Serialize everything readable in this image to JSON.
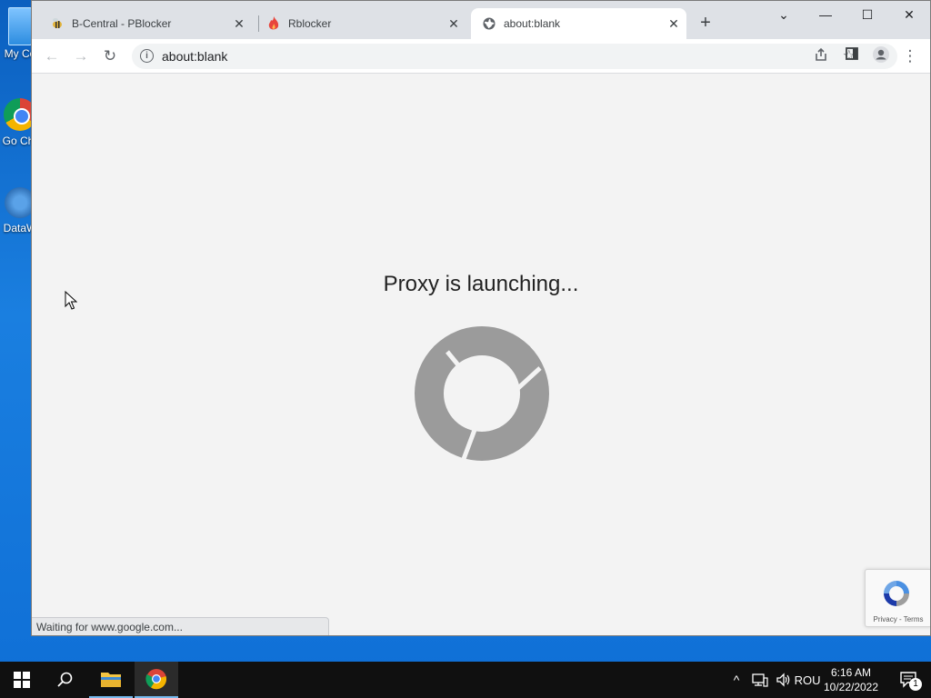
{
  "desktop": {
    "icons": [
      {
        "label": "My Co"
      },
      {
        "label": "Go Chr"
      },
      {
        "label": "DataW"
      }
    ]
  },
  "browser": {
    "tabs": [
      {
        "title": "B-Central - PBlocker",
        "icon": "bee-icon"
      },
      {
        "title": "Rblocker",
        "icon": "flame-icon"
      },
      {
        "title": "about:blank",
        "icon": "globe-icon",
        "active": true
      }
    ],
    "new_tab_label": "+",
    "window_controls": {
      "tab_search": "⌄",
      "minimize": "—",
      "maximize": "☐",
      "close": "✕"
    },
    "toolbar": {
      "back": "←",
      "forward": "→",
      "reload": "↻",
      "url": "about:blank",
      "info": "i"
    }
  },
  "page": {
    "heading": "Proxy is launching...",
    "status": "Waiting for www.google.com...",
    "recaptcha_terms": "Privacy - Terms"
  },
  "taskbar": {
    "language": "ROU",
    "time": "6:16 AM",
    "date": "10/22/2022",
    "notification_count": "1"
  },
  "colors": {
    "desktop_blue": "#0b5fbf",
    "spinner_gray": "#9b9b9b",
    "tab_strip": "#dee1e6"
  }
}
